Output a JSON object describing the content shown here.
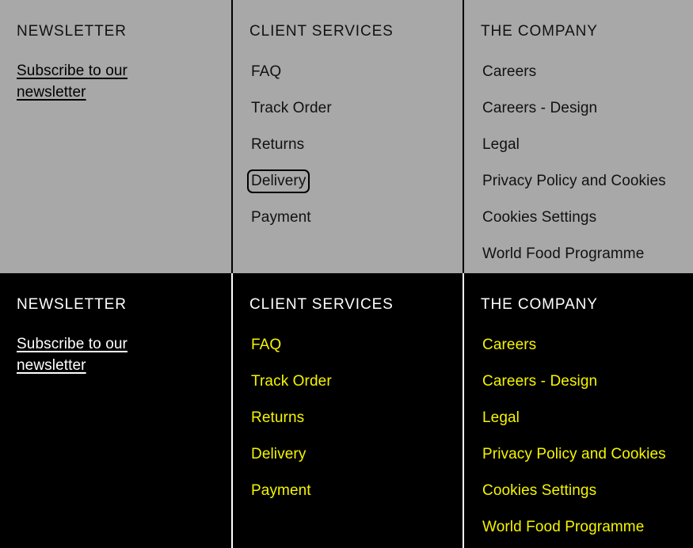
{
  "colors": {
    "light_background": "#a8a8a8",
    "dark_background": "#000000",
    "link_yellow": "#f5f500",
    "light_text": "#111111",
    "dark_text": "#ffffff",
    "focus_ring": "#000000"
  },
  "sections": [
    {
      "theme": "light",
      "columns": [
        {
          "heading": "NEWSLETTER",
          "newsletter_link": "Subscribe to our newsletter",
          "links": []
        },
        {
          "heading": "CLIENT SERVICES",
          "links": [
            {
              "label": "FAQ",
              "focused": false
            },
            {
              "label": "Track Order",
              "focused": false
            },
            {
              "label": "Returns",
              "focused": false
            },
            {
              "label": "Delivery",
              "focused": true
            },
            {
              "label": "Payment",
              "focused": false
            }
          ]
        },
        {
          "heading": "THE COMPANY",
          "links": [
            {
              "label": "Careers",
              "focused": false
            },
            {
              "label": "Careers - Design",
              "focused": false
            },
            {
              "label": "Legal",
              "focused": false
            },
            {
              "label": "Privacy Policy and Cookies",
              "focused": false
            },
            {
              "label": "Cookies Settings",
              "focused": false
            },
            {
              "label": "World Food Programme",
              "focused": false
            }
          ]
        }
      ]
    },
    {
      "theme": "dark",
      "columns": [
        {
          "heading": "NEWSLETTER",
          "newsletter_link": "Subscribe to our newsletter",
          "links": []
        },
        {
          "heading": "CLIENT SERVICES",
          "links": [
            {
              "label": "FAQ",
              "focused": false
            },
            {
              "label": "Track Order",
              "focused": false
            },
            {
              "label": "Returns",
              "focused": false
            },
            {
              "label": "Delivery",
              "focused": false
            },
            {
              "label": "Payment",
              "focused": false
            }
          ]
        },
        {
          "heading": "THE COMPANY",
          "links": [
            {
              "label": "Careers",
              "focused": false
            },
            {
              "label": "Careers - Design",
              "focused": false
            },
            {
              "label": "Legal",
              "focused": false
            },
            {
              "label": "Privacy Policy and Cookies",
              "focused": false
            },
            {
              "label": "Cookies Settings",
              "focused": false
            },
            {
              "label": "World Food Programme",
              "focused": false
            }
          ]
        }
      ]
    }
  ]
}
